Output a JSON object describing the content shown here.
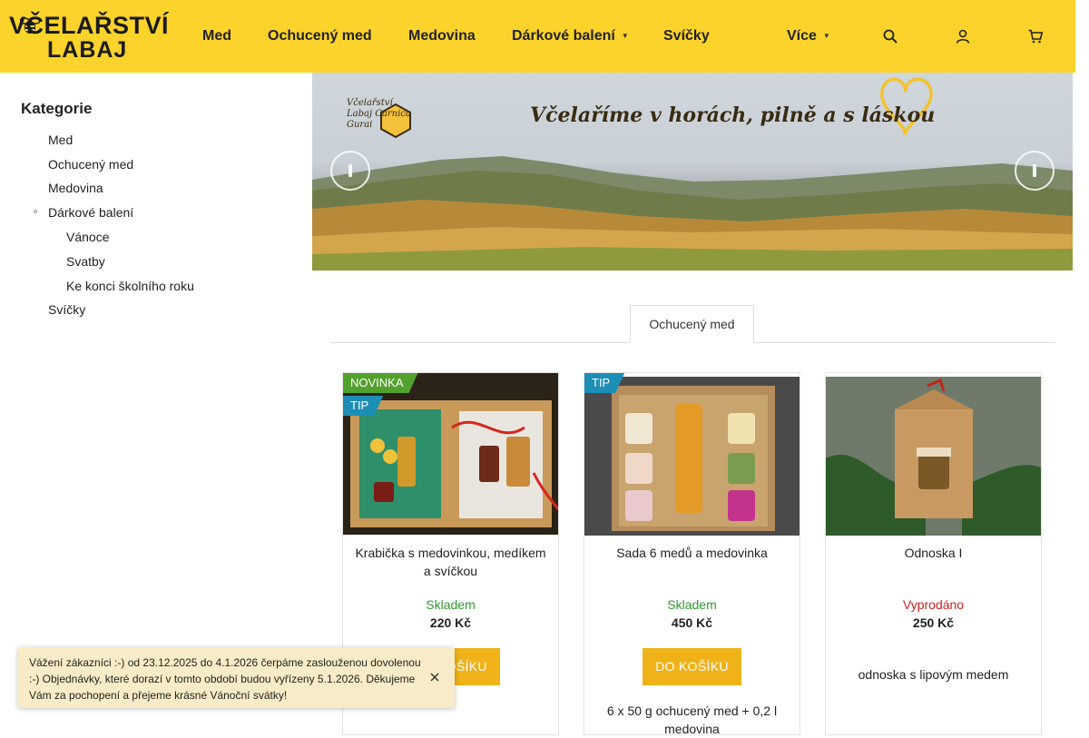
{
  "brand": {
    "line1": "VČELAŘSTVÍ",
    "line2": "LABAJ"
  },
  "nav": {
    "items": [
      {
        "label": "Med"
      },
      {
        "label": "Ochucený med"
      },
      {
        "label": "Medovina"
      },
      {
        "label": "Dárkové balení",
        "has_dropdown": true
      },
      {
        "label": "Svíčky"
      },
      {
        "label": "Více",
        "has_dropdown": true
      }
    ],
    "icons": [
      "search-icon",
      "user-icon",
      "cart-icon"
    ]
  },
  "sidebar": {
    "title": "Kategorie",
    "items": [
      {
        "label": "Med",
        "level": 1
      },
      {
        "label": "Ochucený med",
        "level": 1
      },
      {
        "label": "Medovina",
        "level": 1
      },
      {
        "label": "Dárkové balení",
        "level": 1,
        "expanded": true
      },
      {
        "label": "Vánoce",
        "level": 2
      },
      {
        "label": "Svatby",
        "level": 2
      },
      {
        "label": "Ke konci školního roku",
        "level": 2
      },
      {
        "label": "Svíčky",
        "level": 1
      }
    ]
  },
  "banner": {
    "slogan": "Včelaříme v horách, pilně a s láskou",
    "logo_text": "Včelařství Labaj Carnica Gurai"
  },
  "tabs": [
    {
      "label": "Ochucený med",
      "active": true
    }
  ],
  "products": [
    {
      "flags": [
        "NOVINKA",
        "TIP"
      ],
      "name": "Krabička s medovinkou, medíkem a svíčkou",
      "stock": "Skladem",
      "in_stock": true,
      "price": "220 Kč",
      "button": "DO KOŠÍKU"
    },
    {
      "flags": [
        "TIP"
      ],
      "name": "Sada 6 medů a medovinka",
      "stock": "Skladem",
      "in_stock": true,
      "price": "450 Kč",
      "button": "DO KOŠÍKU",
      "description": "6 x 50 g ochucený med + 0,2 l medovina"
    },
    {
      "flags": [],
      "name": "Odnoska I",
      "stock": "Vyprodáno",
      "in_stock": false,
      "price": "250 Kč",
      "description": "odnoska s lipovým medem"
    }
  ],
  "notice": {
    "text": "Vážení zákazníci :-) od 23.12.2025 do 4.1.2026 čerpáme zaslouženou dovolenou :-) Objednávky, které dorazí v tomto období budou vyřízeny 5.1.2026. Děkujeme Vám za pochopení a přejeme krásné Vánoční svátky!"
  },
  "colors": {
    "header_bg": "#fbd32a",
    "button_bg": "#f0b219",
    "in_stock": "#2e9a2e",
    "out_of_stock": "#d0201e",
    "flag_new": "#53a12d",
    "flag_tip": "#1d8eb6",
    "notice_bg": "#f7ecc7"
  }
}
